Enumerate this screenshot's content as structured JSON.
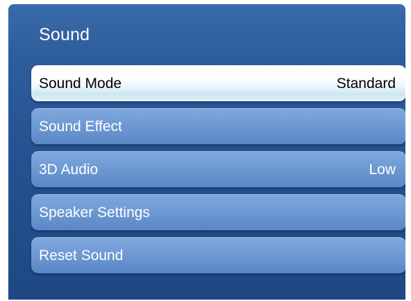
{
  "panel": {
    "title": "Sound"
  },
  "menu": {
    "items": [
      {
        "label": "Sound Mode",
        "value": "Standard",
        "selected": true
      },
      {
        "label": "Sound Effect",
        "value": ""
      },
      {
        "label": "3D Audio",
        "value": "Low"
      },
      {
        "label": "Speaker Settings",
        "value": ""
      },
      {
        "label": "Reset Sound",
        "value": ""
      }
    ]
  },
  "colors": {
    "panel_background": "#2a5997",
    "item_background": "#6e9ad3",
    "selected_item_background": "#eef6fc",
    "text": "#ffffff",
    "selected_text": "#000000"
  }
}
